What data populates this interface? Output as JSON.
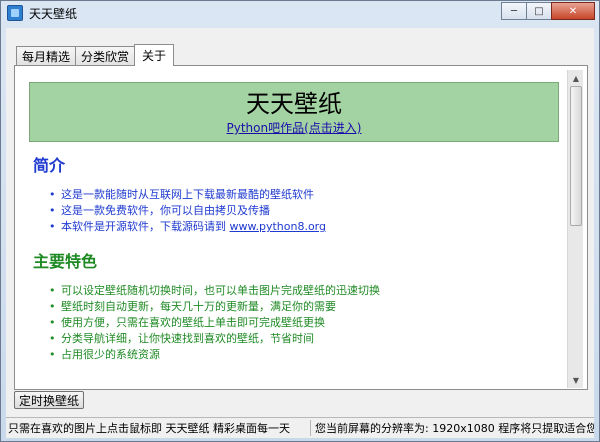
{
  "window": {
    "title": "天天壁纸"
  },
  "tabs": [
    {
      "label": "每月精选"
    },
    {
      "label": "分类欣赏"
    },
    {
      "label": "关于"
    }
  ],
  "about": {
    "banner_title": "天天壁纸",
    "banner_link": "Python吧作品(点击进入)",
    "intro_heading": "简介",
    "intro_items": [
      "这是一款能随时从互联网上下载最新最酷的壁纸软件",
      "这是一款免费软件，你可以自由拷贝及传播",
      "本软件是开源软件，下载源码请到 "
    ],
    "intro_link": "www.python8.org",
    "features_heading": "主要特色",
    "features_items": [
      "可以设定壁纸随机切换时间，也可以单击图片完成壁纸的迅速切换",
      "壁纸时刻自动更新，每天几十万的更新量，满足你的需要",
      "使用方便，只需在喜欢的壁纸上单击即可完成壁纸更换",
      "分类导航详细，让你快速找到喜欢的壁纸，节省时间",
      "占用很少的系统资源"
    ]
  },
  "bottom": {
    "timer_button": "定时换壁纸"
  },
  "status": {
    "left": "只需在喜欢的图片上点击鼠标即 天天壁纸 精彩桌面每一天",
    "right": "您当前屏幕的分辨率为: 1920x1080 程序将只提取适合您屏幕"
  },
  "colors": {
    "banner_bg": "#a3d3a2",
    "intro_color": "#1f3ad0",
    "features_color": "#1f8a24"
  }
}
